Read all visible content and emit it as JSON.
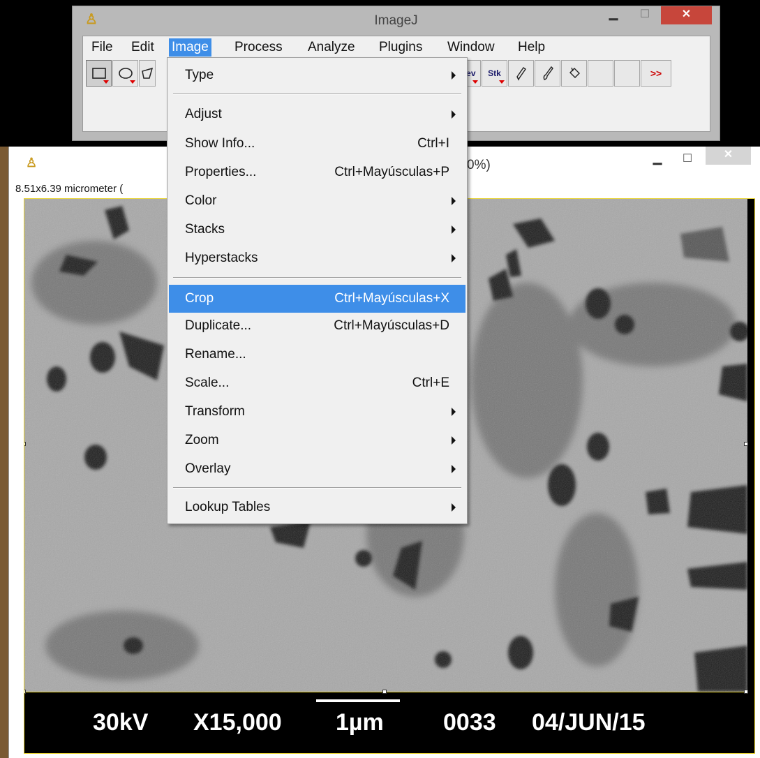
{
  "ij_window": {
    "title": "ImageJ",
    "menu": [
      "File",
      "Edit",
      "Image",
      "Process",
      "Analyze",
      "Plugins",
      "Window",
      "Help"
    ],
    "active_menu": "Image",
    "toolbar": {
      "dev_label": "Dev",
      "stk_label": "Stk",
      "more_label": ">>"
    }
  },
  "image_window": {
    "title_partial": "0%)",
    "info_partial": "8.51x6.39 micrometer (",
    "databar": {
      "voltage": "30kV",
      "magnification": "X15,000",
      "scale": "1µm",
      "number": "0033",
      "date": "04/JUN/15"
    }
  },
  "image_menu": {
    "items": [
      {
        "label": "Type",
        "shortcut": "",
        "submenu": true
      },
      {
        "label": "Adjust",
        "shortcut": "",
        "submenu": true
      },
      {
        "label": "Show Info...",
        "shortcut": "Ctrl+I",
        "submenu": false
      },
      {
        "label": "Properties...",
        "shortcut": "Ctrl+Mayúsculas+P",
        "submenu": false
      },
      {
        "label": "Color",
        "shortcut": "",
        "submenu": true
      },
      {
        "label": "Stacks",
        "shortcut": "",
        "submenu": true
      },
      {
        "label": "Hyperstacks",
        "shortcut": "",
        "submenu": true
      },
      {
        "label": "Crop",
        "shortcut": "Ctrl+Mayúsculas+X",
        "submenu": false
      },
      {
        "label": "Duplicate...",
        "shortcut": "Ctrl+Mayúsculas+D",
        "submenu": false
      },
      {
        "label": "Rename...",
        "shortcut": "",
        "submenu": false
      },
      {
        "label": "Scale...",
        "shortcut": "Ctrl+E",
        "submenu": false
      },
      {
        "label": "Transform",
        "shortcut": "",
        "submenu": true
      },
      {
        "label": "Zoom",
        "shortcut": "",
        "submenu": true
      },
      {
        "label": "Overlay",
        "shortcut": "",
        "submenu": true
      },
      {
        "label": "Lookup Tables",
        "shortcut": "",
        "submenu": true
      }
    ],
    "highlighted": "Crop"
  },
  "colors": {
    "highlight": "#3e8ee8",
    "close_button": "#c7463b",
    "selection_outline": "#e6d230"
  }
}
